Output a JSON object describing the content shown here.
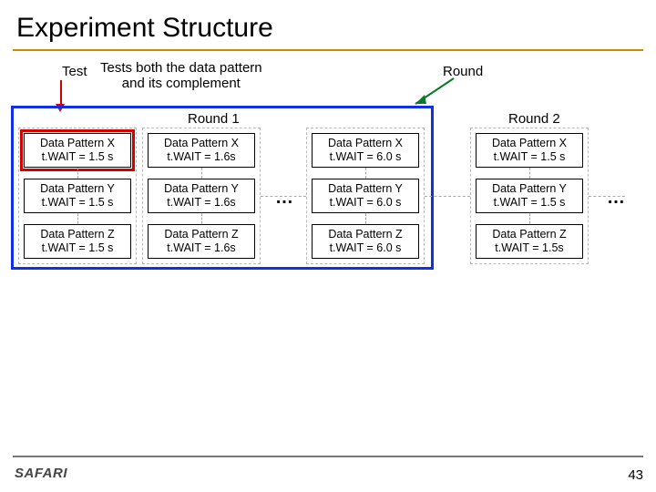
{
  "slide": {
    "title": "Experiment Structure",
    "labels": {
      "test": "Test",
      "desc_l1": "Tests both the data pattern",
      "desc_l2": "and its complement",
      "round": "Round"
    },
    "rounds": [
      {
        "title": "Round 1",
        "columns": [
          {
            "cells": [
              "Data Pattern X\nt.WAIT = 1.5 s",
              "Data Pattern Y\nt.WAIT = 1.5 s",
              "Data Pattern Z\nt.WAIT = 1.5 s"
            ]
          },
          {
            "cells": [
              "Data Pattern X\nt.WAIT = 1.6s",
              "Data Pattern Y\nt.WAIT = 1.6s",
              "Data Pattern Z\nt.WAIT = 1.6s"
            ]
          },
          {
            "ellipsis": "…"
          },
          {
            "cells": [
              "Data Pattern X\nt.WAIT = 6.0 s",
              "Data Pattern Y\nt.WAIT = 6.0 s",
              "Data Pattern Z\nt.WAIT = 6.0 s"
            ]
          }
        ]
      },
      {
        "title": "Round 2",
        "columns": [
          {
            "cells": [
              "Data Pattern X\nt.WAIT = 1.5 s",
              "Data Pattern Y\nt.WAIT = 1.5 s",
              "Data Pattern Z\nt.WAIT = 1.5s"
            ]
          }
        ],
        "trailing_ellipsis": "…"
      }
    ],
    "footer": {
      "logo": "SAFARI",
      "page": "43"
    }
  }
}
